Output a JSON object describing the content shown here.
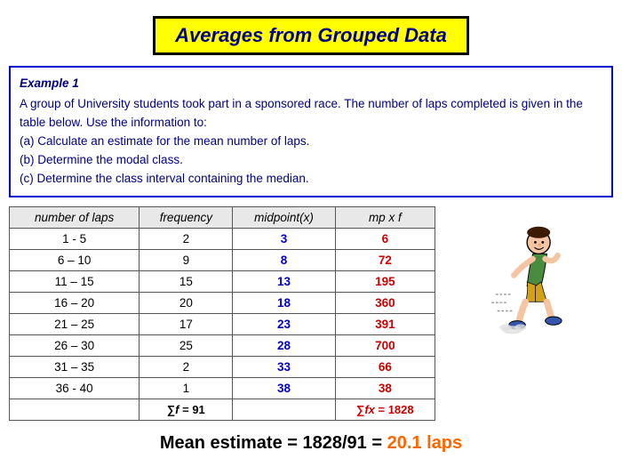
{
  "title": "Averages from Grouped Data",
  "example": {
    "label": "Example 1",
    "text_lines": [
      "A group of University students took part in a sponsored race. The number of",
      "laps completed is given in the table below. Use the information to:",
      "(a) Calculate an estimate for the mean number of laps.",
      "(b) Determine the modal class.",
      "(c) Determine the class interval containing the median."
    ]
  },
  "table": {
    "headers": [
      "number of laps",
      "frequency",
      "midpoint(x)",
      "mp x f"
    ],
    "rows": [
      {
        "laps": "1 - 5",
        "freq": "2",
        "mp": "3",
        "mpf": "6"
      },
      {
        "laps": "6 – 10",
        "freq": "9",
        "mp": "8",
        "mpf": "72"
      },
      {
        "laps": "11 – 15",
        "freq": "15",
        "mp": "13",
        "mpf": "195"
      },
      {
        "laps": "16 – 20",
        "freq": "20",
        "mp": "18",
        "mpf": "360"
      },
      {
        "laps": "21 – 25",
        "freq": "17",
        "mp": "23",
        "mpf": "391"
      },
      {
        "laps": "26 – 30",
        "freq": "25",
        "mp": "28",
        "mpf": "700"
      },
      {
        "laps": "31 – 35",
        "freq": "2",
        "mp": "33",
        "mpf": "66"
      },
      {
        "laps": "36 - 40",
        "freq": "1",
        "mp": "38",
        "mpf": "38"
      }
    ],
    "sum_row": {
      "freq_sum": "∑f = 91",
      "mpf_sum": "∑fx = 1828"
    }
  },
  "mean_estimate": {
    "text": "Mean estimate = 1828/91 = ",
    "value": "20.1 laps"
  }
}
